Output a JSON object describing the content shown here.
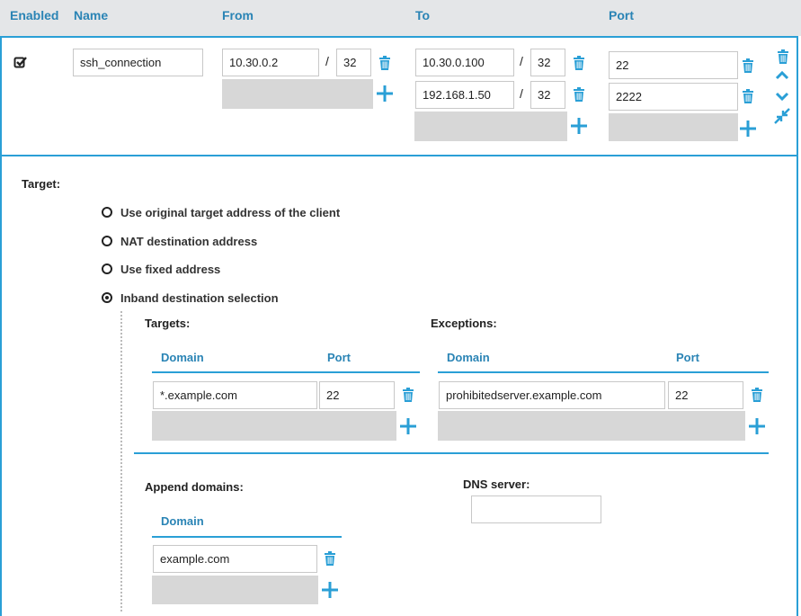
{
  "header": {
    "enabled": "Enabled",
    "name": "Name",
    "from": "From",
    "to": "To",
    "port": "Port"
  },
  "row": {
    "enabled_checked": true,
    "name_value": "ssh_connection",
    "from": [
      {
        "address": "10.30.0.2",
        "mask": "32"
      }
    ],
    "to": [
      {
        "address": "10.30.0.100",
        "mask": "32"
      },
      {
        "address": "192.168.1.50",
        "mask": "32"
      }
    ],
    "ports": [
      "22",
      "2222"
    ],
    "slash": "/"
  },
  "target": {
    "label": "Target:",
    "options": [
      {
        "label": "Use original target address of the client",
        "selected": false
      },
      {
        "label": "NAT destination address",
        "selected": false
      },
      {
        "label": "Use fixed address",
        "selected": false
      },
      {
        "label": "Inband destination selection",
        "selected": true
      }
    ]
  },
  "inband": {
    "targets": {
      "title": "Targets:",
      "col_domain": "Domain",
      "col_port": "Port",
      "rows": [
        {
          "domain": "*.example.com",
          "port": "22"
        }
      ]
    },
    "exceptions": {
      "title": "Exceptions:",
      "col_domain": "Domain",
      "col_port": "Port",
      "rows": [
        {
          "domain": "prohibitedserver.example.com",
          "port": "22"
        }
      ]
    },
    "append": {
      "title": "Append domains:",
      "col_domain": "Domain",
      "rows": [
        {
          "domain": "example.com"
        }
      ]
    },
    "dns": {
      "title": "DNS server:",
      "value": ""
    }
  },
  "colors": {
    "accent": "#2a9fd6",
    "header_text": "#2a84b5",
    "header_bg": "#e4e6e8",
    "empty_field": "#d7d7d7"
  },
  "icons": [
    "checkbox-checked-icon",
    "trash-icon",
    "plus-icon",
    "chevron-up-icon",
    "chevron-down-icon",
    "collapse-icon"
  ]
}
